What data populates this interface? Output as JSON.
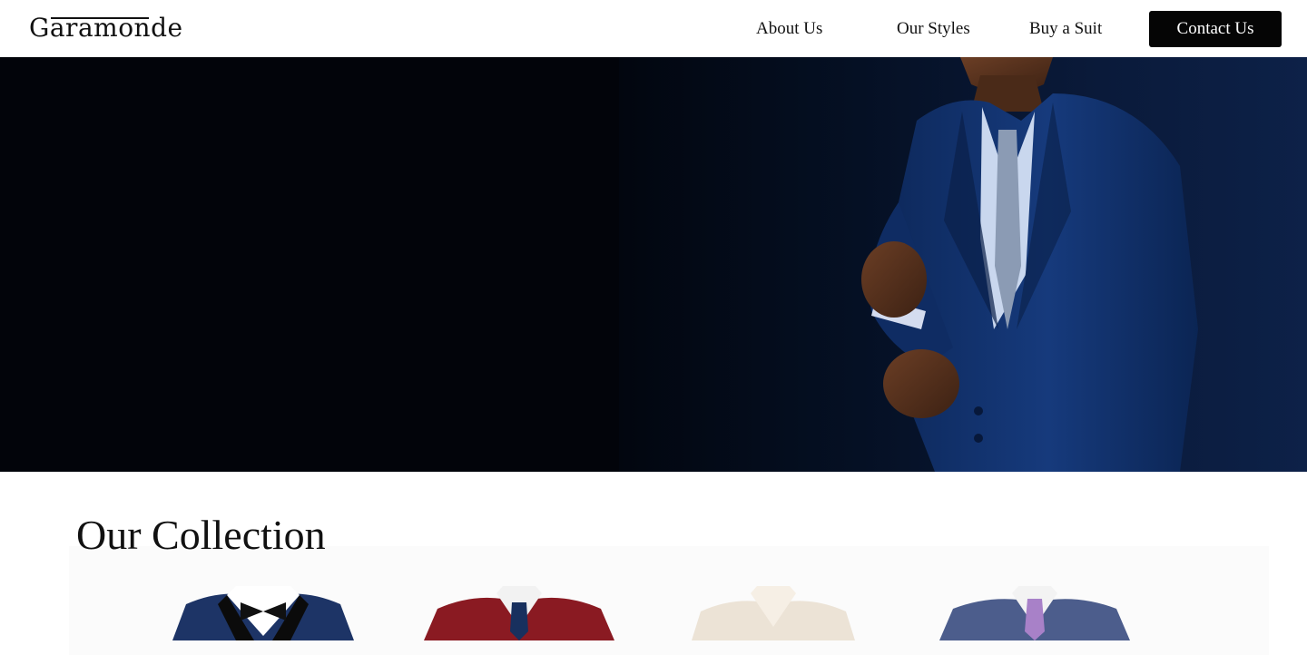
{
  "brand": {
    "name": "Garamonde"
  },
  "nav": {
    "items": [
      {
        "label": "About Us"
      },
      {
        "label": "Our Styles"
      },
      {
        "label": "Buy a Suit"
      }
    ],
    "cta_label": "Contact Us"
  },
  "hero": {
    "image": "man-in-navy-suit-adjusting-cuff"
  },
  "collection": {
    "title": "Our Collection",
    "products": [
      {
        "image": "navy-tuxedo-black-bowtie"
      },
      {
        "image": "burgundy-suit-navy-tie"
      },
      {
        "image": "cream-suit-jacket"
      },
      {
        "image": "blue-check-suit-purple-tie"
      }
    ]
  },
  "colors": {
    "cta_background": "#050505",
    "hero_background": "#02040a",
    "suit_navy": "#123a7a"
  }
}
